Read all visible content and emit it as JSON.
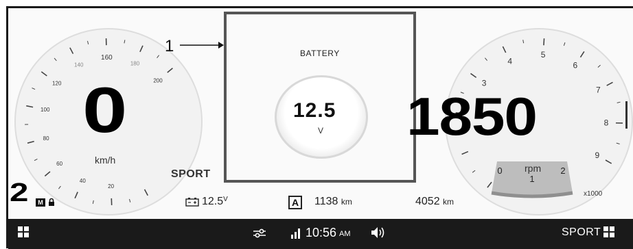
{
  "callout": {
    "number": "1"
  },
  "battery": {
    "title": "BATTERY",
    "value": "12.5",
    "unit": "V"
  },
  "speedometer": {
    "speed": "0",
    "unit": "km/h",
    "ticks": [
      "20",
      "40",
      "60",
      "80",
      "100",
      "120",
      "140",
      "160",
      "180",
      "200"
    ],
    "tick_values": [
      0,
      20,
      40,
      60,
      80,
      100,
      120,
      140,
      160,
      180,
      200
    ]
  },
  "tachometer": {
    "rpm": "1850",
    "unit": "rpm",
    "multiplier": "x1000",
    "ticks": [
      "0",
      "1",
      "2",
      "3",
      "4",
      "5",
      "6",
      "7",
      "8",
      "9"
    ],
    "tick_values": [
      0,
      1,
      2,
      3,
      4,
      5,
      6,
      7,
      8,
      9
    ]
  },
  "drive": {
    "mode": "SPORT",
    "gear": "2",
    "manual_badge": "M"
  },
  "status": {
    "battery_voltage": "12.5",
    "battery_unit": "V",
    "trip_badge": "A",
    "trip_value": "1138",
    "trip_unit": "km",
    "odometer_value": "4052",
    "odometer_unit": "km"
  },
  "bottom_bar": {
    "time": "10:56",
    "ampm": "AM",
    "mode": "SPORT",
    "icons": [
      "menu-grid-icon",
      "settings-sliders-icon",
      "signal-bars-icon",
      "volume-icon",
      "menu-grid-icon"
    ]
  }
}
